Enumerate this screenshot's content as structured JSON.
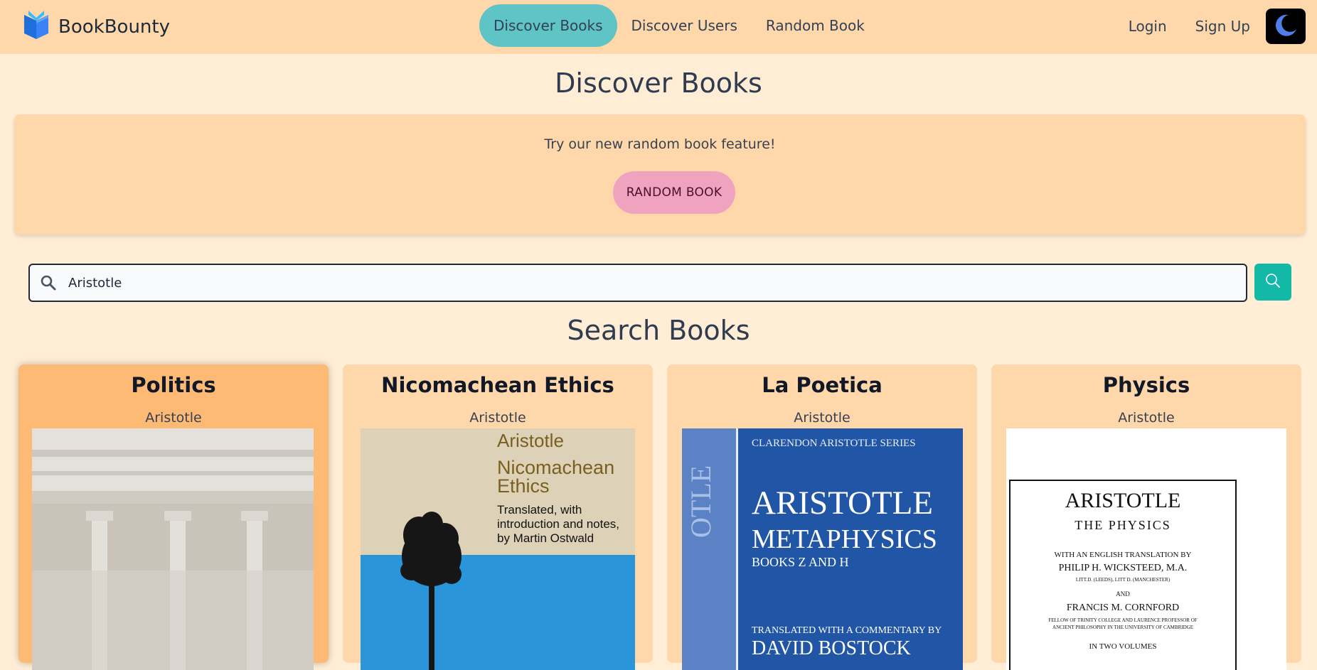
{
  "nav": {
    "brand": "BookBounty",
    "links": [
      "Discover Books",
      "Discover Users",
      "Random Book"
    ],
    "login": "Login",
    "signup": "Sign Up"
  },
  "page_title": "Discover Books",
  "banner": {
    "text": "Try our new random book feature!",
    "button": "RANDOM BOOK"
  },
  "search": {
    "value": "Aristotle",
    "placeholder": ""
  },
  "section_title": "Search Books",
  "books": [
    {
      "title": "Politics",
      "author": "Aristotle"
    },
    {
      "title": "Nicomachean Ethics",
      "author": "Aristotle",
      "cover": {
        "author": "Aristotle",
        "title_1": "Nicomachean",
        "title_2": "Ethics",
        "note_1": "Translated, with",
        "note_2": "introduction and notes,",
        "note_3": "by Martin Ostwald"
      }
    },
    {
      "title": "La Poetica",
      "author": "Aristotle",
      "cover": {
        "series": "CLARENDON ARISTOTLE SERIES",
        "name": "ARISTOTLE",
        "work": "METAPHYSICS",
        "books": "BOOKS Z AND H",
        "credit": "TRANSLATED WITH A COMMENTARY BY",
        "translator": "DAVID BOSTOCK",
        "spine": "OTLE"
      }
    },
    {
      "title": "Physics",
      "author": "Aristotle",
      "cover": {
        "name": "ARISTOTLE",
        "work": "THE PHYSICS",
        "line_1": "WITH AN ENGLISH TRANSLATION BY",
        "line_2": "PHILIP H. WICKSTEED, M.A.",
        "line_3": "LITT.D. (LEEDS), LITT D. (MANCHESTER)",
        "line_4": "AND",
        "line_5": "FRANCIS M. CORNFORD",
        "line_6": "FELLOW OF TRINITY COLLEGE AND LAURENCE PROFESSOR OF",
        "line_7": "ANCIENT PHILOSOPHY IN THE UNIVERSITY OF CAMBRIDGE",
        "line_8": "IN TWO VOLUMES"
      }
    }
  ],
  "colors": {
    "page_bg": "#ffedd5",
    "nav_bg": "#fed7aa",
    "active_nav": "#5fc4c6",
    "random_button": "#f0a3bf",
    "search_button": "#14b8a6",
    "card_bg": "#fed7aa",
    "card_highlight": "#fdba74"
  },
  "icons": [
    "logo-book-icon",
    "moon-icon",
    "search-icon",
    "search-button-icon"
  ]
}
